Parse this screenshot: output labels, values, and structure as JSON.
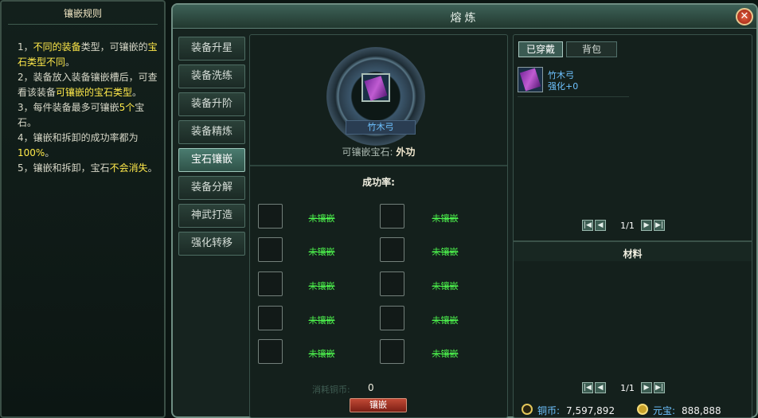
{
  "rules": {
    "title": "镶嵌规则",
    "lines": [
      {
        "prefix": "1，",
        "hl1": "不同的装备",
        "mid": "类型，可镶嵌的",
        "hl2": "宝石类型不同",
        "suffix": "。"
      },
      {
        "prefix": "2，装备放入装备镶嵌槽后，可查看该装备",
        "hl1": "可镶嵌的宝石类型",
        "mid": "",
        "hl2": "",
        "suffix": "。"
      },
      {
        "prefix": "3，每件装备最多可镶嵌",
        "hl1": "5个",
        "mid": "宝石",
        "hl2": "",
        "suffix": "。"
      },
      {
        "prefix": "4，镶嵌和拆卸的成功率都为",
        "hl1": "100%",
        "mid": "",
        "hl2": "",
        "suffix": "。"
      },
      {
        "prefix": "5，镶嵌和拆卸，宝石",
        "hl1": "不会消失",
        "mid": "",
        "hl2": "",
        "suffix": "。"
      }
    ]
  },
  "window": {
    "title": "熔炼",
    "close": "✕"
  },
  "nav": [
    {
      "label": "装备升星",
      "active": false
    },
    {
      "label": "装备洗练",
      "active": false
    },
    {
      "label": "装备升阶",
      "active": false
    },
    {
      "label": "装备精炼",
      "active": false
    },
    {
      "label": "宝石镶嵌",
      "active": true
    },
    {
      "label": "装备分解",
      "active": false
    },
    {
      "label": "神武打造",
      "active": false
    },
    {
      "label": "强化转移",
      "active": false
    }
  ],
  "center": {
    "equip_name": "竹木弓",
    "gem_type_label": "可镶嵌宝石:",
    "gem_type_value": "外功",
    "rate_label": "成功率:",
    "slots": [
      "未镶嵌",
      "未镶嵌",
      "未镶嵌",
      "未镶嵌",
      "未镶嵌",
      "未镶嵌",
      "未镶嵌",
      "未镶嵌",
      "未镶嵌",
      "未镶嵌"
    ],
    "cost_label": "消耗铜币:",
    "cost_value": "0",
    "inlay_button": "镶嵌"
  },
  "right": {
    "tabs": [
      {
        "label": "已穿戴",
        "active": true
      },
      {
        "label": "背包",
        "active": false
      }
    ],
    "item": {
      "name": "竹木弓",
      "level": "强化+0"
    },
    "pager_top": "1/1",
    "materials_label": "材料",
    "pager_bottom": "1/1",
    "currency": {
      "copper_label": "铜币:",
      "copper_value": "7,597,892",
      "yuanbao_label": "元宝:",
      "yuanbao_value": "888,888"
    }
  }
}
